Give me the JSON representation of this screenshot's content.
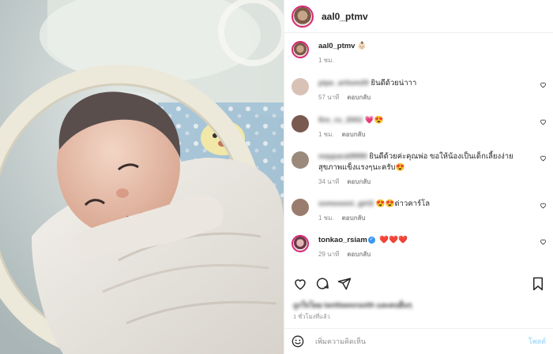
{
  "post": {
    "username": "aal0_ptmv",
    "media_alt": "newborn baby in incubator"
  },
  "caption": {
    "username": "aal0_ptmv",
    "text": "👶🏻",
    "time": "1 ชม."
  },
  "comments": [
    {
      "username": "pipe_artism20",
      "username_blurred": true,
      "text": "ยินดีด้วยน่าาา",
      "time": "57 นาที",
      "reply": "ตอบกลับ",
      "avatar_color": "#d8c2b6"
    },
    {
      "username": "fire_ru_2002",
      "username_blurred": true,
      "text": "💗😍",
      "time": "1 ชม.",
      "reply": "ตอบกลับ",
      "avatar_color": "#7a5a50"
    },
    {
      "username": "nopparat9990",
      "username_blurred": true,
      "text": "ยินดีด้วยค่ะคุณพ่อ ขอให้น้องเป็นเด็กเลี้ยงง่าย สุขภาพแข็งแรงๆนะครับ😍",
      "time": "34 นาที",
      "reply": "ตอบกลับ",
      "avatar_color": "#9b8a7c"
    },
    {
      "username": "somsooni_girl2",
      "username_blurred": true,
      "text": "😍😍ด่าวคาร์โล",
      "time": "1 ชม.",
      "reply": "ตอบกลับ",
      "avatar_color": "#9a7c6e"
    },
    {
      "username": "tonkao_rsiam",
      "username_blurred": false,
      "verified": true,
      "text": "❤️❤️❤️",
      "time": "29 นาที",
      "reply": "ตอบกลับ",
      "avatar_color": "#b0607a"
    }
  ],
  "actions": {
    "like_icon": "heart-icon",
    "comment_icon": "comment-icon",
    "share_icon": "send-icon",
    "save_icon": "bookmark-icon"
  },
  "likes_text": "ถูกใจโดย tanittaworasith และคนอื่นๆ",
  "post_time": "1 ชั่วโมงที่แล้ว",
  "composer": {
    "emoji_icon": "smiley-icon",
    "placeholder": "เพิ่มความคิดเห็น",
    "post_label": "โพสต์"
  },
  "colors": {
    "accent": "#0095f6",
    "accent_disabled": "#b2dffc",
    "heart_red": "#ed4956",
    "muted": "#8e8e8e",
    "story_ring": "#d62976"
  }
}
